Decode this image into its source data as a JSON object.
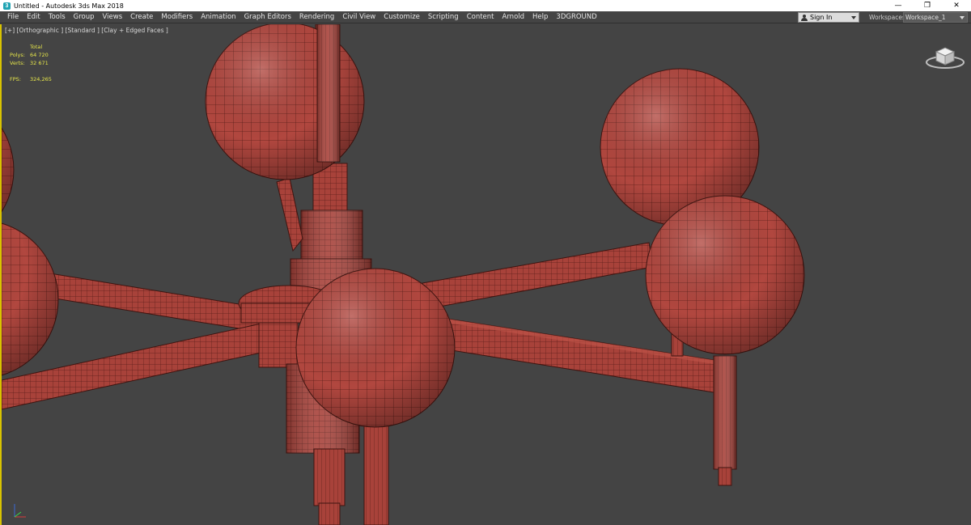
{
  "window": {
    "title": "Untitled - Autodesk 3ds Max 2018",
    "controls": {
      "minimize": "—",
      "restore": "❐",
      "close": "✕"
    }
  },
  "menu": {
    "items": [
      "File",
      "Edit",
      "Tools",
      "Group",
      "Views",
      "Create",
      "Modifiers",
      "Animation",
      "Graph Editors",
      "Rendering",
      "Civil View",
      "Customize",
      "Scripting",
      "Content",
      "Arnold",
      "Help",
      "3DGROUND"
    ],
    "sign_in": "Sign In",
    "workspaces_label": "Workspaces:",
    "workspace_value": "Workspace_1"
  },
  "viewport": {
    "label": "[+] [Orthographic ] [Standard ] [Clay + Edged Faces ]",
    "stats": {
      "total_label": "Total",
      "polys_label": "Polys:",
      "polys_value": "64 720",
      "verts_label": "Verts:",
      "verts_value": "32 671",
      "fps_label": "FPS:",
      "fps_value": "324,265"
    },
    "model_color": "#b1473f",
    "background_color": "#444444",
    "active_border_color": "#d9c300"
  },
  "icons": {
    "app": "3ds-max-app-icon",
    "viewcube": "viewcube-icon",
    "axis": "axis-tripod-icon",
    "user": "user-icon"
  }
}
